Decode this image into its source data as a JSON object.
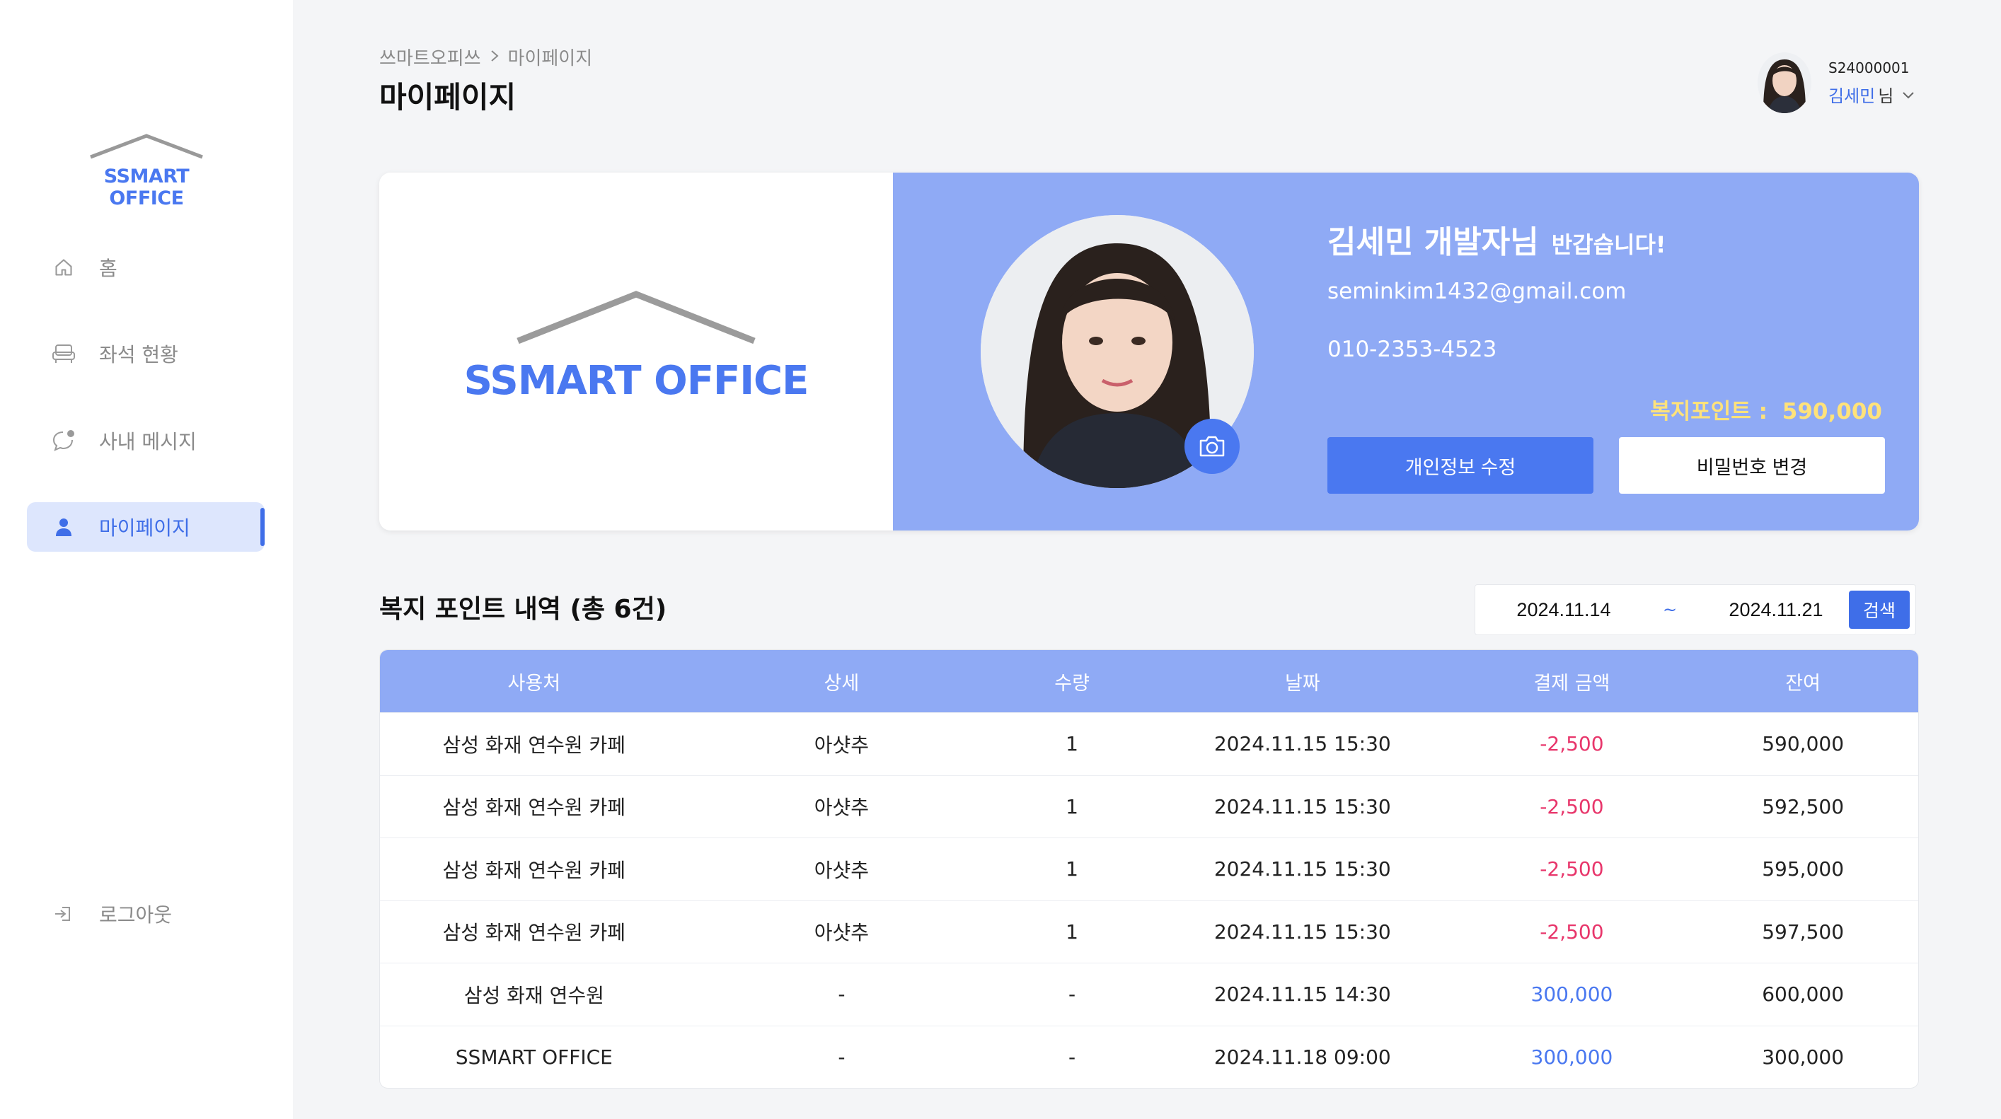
{
  "sidebar": {
    "logo_text": "SSMART OFFICE",
    "items": [
      {
        "label": "홈",
        "icon": "home-icon"
      },
      {
        "label": "좌석 현황",
        "icon": "seat-icon"
      },
      {
        "label": "사내 메시지",
        "icon": "chat-icon"
      },
      {
        "label": "마이페이지",
        "icon": "user-icon",
        "active": true
      }
    ],
    "logout_label": "로그아웃"
  },
  "header": {
    "breadcrumb": [
      "쓰마트오피쓰",
      "마이페이지"
    ],
    "title": "마이페이지",
    "user": {
      "id": "S24000001",
      "name": "김세민",
      "honorific": "님"
    }
  },
  "profile": {
    "logo_text": "SSMART OFFICE",
    "greeting_name": "김세민 개발자님",
    "greeting_suffix": "반갑습니다!",
    "email": "seminkim1432@gmail.com",
    "phone": "010-2353-4523",
    "points_label": "복지포인트 :",
    "points_value": "590,000",
    "edit_button": "개인정보 수정",
    "password_button": "비밀번호 변경"
  },
  "history": {
    "title": "복지 포인트 내역 (총 6건)",
    "date_from": "2024.11.14",
    "date_separator": "~",
    "date_to": "2024.11.21",
    "search_label": "검색",
    "columns": [
      "사용처",
      "상세",
      "수량",
      "날짜",
      "결제 금액",
      "잔여"
    ],
    "rows": [
      {
        "place": "삼성 화재 연수원 카페",
        "detail": "아샷추",
        "qty": "1",
        "date": "2024.11.15 15:30",
        "amount": "-2,500",
        "balance": "590,000",
        "type": "neg"
      },
      {
        "place": "삼성 화재 연수원 카페",
        "detail": "아샷추",
        "qty": "1",
        "date": "2024.11.15 15:30",
        "amount": "-2,500",
        "balance": "592,500",
        "type": "neg"
      },
      {
        "place": "삼성 화재 연수원 카페",
        "detail": "아샷추",
        "qty": "1",
        "date": "2024.11.15 15:30",
        "amount": "-2,500",
        "balance": "595,000",
        "type": "neg"
      },
      {
        "place": "삼성 화재 연수원 카페",
        "detail": "아샷추",
        "qty": "1",
        "date": "2024.11.15 15:30",
        "amount": "-2,500",
        "balance": "597,500",
        "type": "neg"
      },
      {
        "place": "삼성 화재 연수원",
        "detail": "-",
        "qty": "-",
        "date": "2024.11.15 14:30",
        "amount": "300,000",
        "balance": "600,000",
        "type": "pos"
      },
      {
        "place": "SSMART OFFICE",
        "detail": "-",
        "qty": "-",
        "date": "2024.11.18 09:00",
        "amount": "300,000",
        "balance": "300,000",
        "type": "pos"
      }
    ]
  },
  "colors": {
    "accent": "#4a78f0",
    "card_blue": "#8faaf5",
    "negative": "#e8366b",
    "points_yellow": "#ffe27a"
  }
}
